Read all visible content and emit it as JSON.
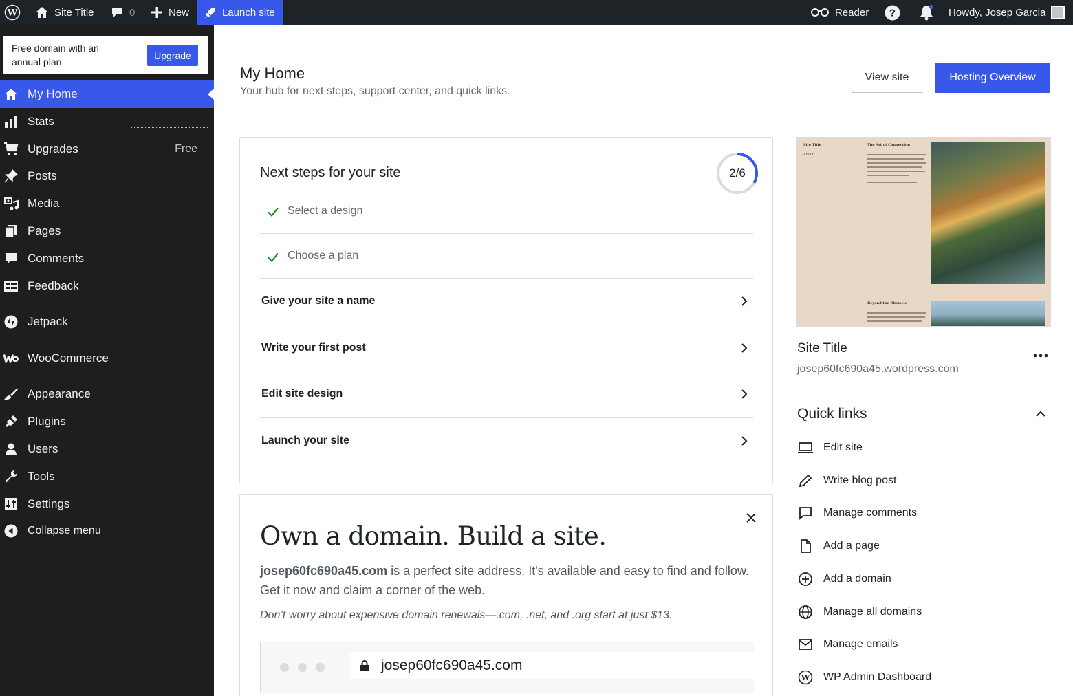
{
  "admin_bar": {
    "site_title": "Site Title",
    "comments_count": "0",
    "new_label": "New",
    "launch_label": "Launch site",
    "reader_label": "Reader",
    "howdy": "Howdy, Josep Garcia"
  },
  "promo": {
    "text": "Free domain with an annual plan",
    "button": "Upgrade"
  },
  "sidebar": {
    "items": [
      {
        "label": "My Home",
        "icon": "home-icon"
      },
      {
        "label": "Stats",
        "icon": "stats-icon"
      },
      {
        "label": "Upgrades",
        "icon": "cart-icon",
        "badge": "Free"
      },
      {
        "label": "Posts",
        "icon": "pin-icon"
      },
      {
        "label": "Media",
        "icon": "media-icon"
      },
      {
        "label": "Pages",
        "icon": "pages-icon"
      },
      {
        "label": "Comments",
        "icon": "comment-icon"
      },
      {
        "label": "Feedback",
        "icon": "feedback-icon"
      },
      {
        "label": "Jetpack",
        "icon": "jetpack-icon"
      },
      {
        "label": "WooCommerce",
        "icon": "woo-icon"
      },
      {
        "label": "Appearance",
        "icon": "brush-icon"
      },
      {
        "label": "Plugins",
        "icon": "plugin-icon"
      },
      {
        "label": "Users",
        "icon": "user-icon"
      },
      {
        "label": "Tools",
        "icon": "wrench-icon"
      },
      {
        "label": "Settings",
        "icon": "settings-icon"
      },
      {
        "label": "Collapse menu",
        "icon": "collapse-icon"
      }
    ]
  },
  "header": {
    "title": "My Home",
    "subtitle": "Your hub for next steps, support center, and quick links.",
    "view_site": "View site",
    "hosting_overview": "Hosting Overview"
  },
  "next_steps": {
    "title": "Next steps for your site",
    "progress_text": "2/6",
    "progress_fraction": 0.333,
    "tasks": [
      {
        "label": "Select a design",
        "done": true
      },
      {
        "label": "Choose a plan",
        "done": true
      },
      {
        "label": "Give your site a name",
        "done": false
      },
      {
        "label": "Write your first post",
        "done": false
      },
      {
        "label": "Edit site design",
        "done": false
      },
      {
        "label": "Launch your site",
        "done": false
      }
    ]
  },
  "domain_card": {
    "title": "Own a domain. Build a site.",
    "domain": "josep60fc690a45.com",
    "body": " is a perfect site address. It's available and easy to find and follow. Get it now and claim a corner of the web.",
    "note": "Don’t worry about expensive domain renewals—.com, .net, and .org start at just $13.",
    "url": "josep60fc690a45.com"
  },
  "site_card": {
    "preview": {
      "nav_title": "Site Title",
      "nav_link": "About",
      "post1_title": "The Art of Connection",
      "post2_title": "Beyond the Obstacle"
    },
    "title": "Site Title",
    "url": "josep60fc690a45.wordpress.com"
  },
  "quick_links": {
    "title": "Quick links",
    "items": [
      {
        "label": "Edit site",
        "icon": "laptop-icon"
      },
      {
        "label": "Write blog post",
        "icon": "pencil-icon"
      },
      {
        "label": "Manage comments",
        "icon": "comment-outline-icon"
      },
      {
        "label": "Add a page",
        "icon": "page-icon"
      },
      {
        "label": "Add a domain",
        "icon": "plus-circle-icon"
      },
      {
        "label": "Manage all domains",
        "icon": "globe-icon"
      },
      {
        "label": "Manage emails",
        "icon": "mail-icon"
      },
      {
        "label": "WP Admin Dashboard",
        "icon": "wordpress-icon"
      }
    ]
  },
  "colors": {
    "accent": "#3858e9",
    "sidebar_bg": "#1e1e1e",
    "adminbar_bg": "#1d2327",
    "check_green": "#008a20"
  }
}
